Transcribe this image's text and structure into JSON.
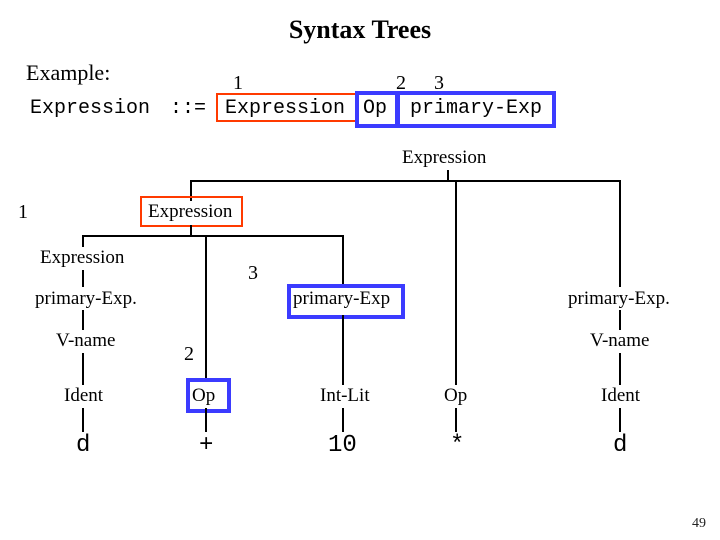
{
  "title": "Syntax Trees",
  "example_label": "Example:",
  "production": {
    "lhs": "Expression",
    "sep": "::=",
    "rhs1": "Expression",
    "rhs2": "Op",
    "rhs3": "primary-Exp",
    "n1": "1",
    "n2": "2",
    "n3": "3"
  },
  "tree": {
    "root": "Expression",
    "n1": "1",
    "expr_mid": "Expression",
    "expr_left": "Expression",
    "n3": "3",
    "prim_left": "primary-Exp.",
    "prim_mid": "primary-Exp",
    "prim_right": "primary-Exp.",
    "vname_left": "V-name",
    "vname_right": "V-name",
    "n2": "2",
    "ident_left": "Ident",
    "int_lit": "Int-Lit",
    "ident_right": "Ident",
    "op_left": "Op",
    "op_right": "Op",
    "leaf_d1": "d",
    "leaf_plus": "+",
    "leaf_10": "10",
    "leaf_star": "*",
    "leaf_d2": "d"
  },
  "page": "49",
  "chart_data": {
    "type": "table",
    "title": "Syntax Trees",
    "production": "Expression ::= Expression Op primary-Exp",
    "terminals": [
      "d",
      "+",
      "10",
      "*",
      "d"
    ],
    "tree": {
      "label": "Expression",
      "children": [
        {
          "label": "Expression",
          "n": 1,
          "children": [
            {
              "label": "Expression",
              "children": [
                {
                  "label": "primary-Exp.",
                  "children": [
                    {
                      "label": "V-name",
                      "children": [
                        {
                          "label": "Ident",
                          "children": [
                            {
                              "label": "d"
                            }
                          ]
                        }
                      ]
                    }
                  ]
                }
              ]
            },
            {
              "label": "Op",
              "n": 2,
              "children": [
                {
                  "label": "+"
                }
              ]
            },
            {
              "label": "primary-Exp",
              "n": 3,
              "children": [
                {
                  "label": "Int-Lit",
                  "children": [
                    {
                      "label": "10"
                    }
                  ]
                }
              ]
            }
          ]
        },
        {
          "label": "Op",
          "children": [
            {
              "label": "*"
            }
          ]
        },
        {
          "label": "primary-Exp.",
          "children": [
            {
              "label": "V-name",
              "children": [
                {
                  "label": "Ident",
                  "children": [
                    {
                      "label": "d"
                    }
                  ]
                }
              ]
            }
          ]
        }
      ]
    }
  }
}
